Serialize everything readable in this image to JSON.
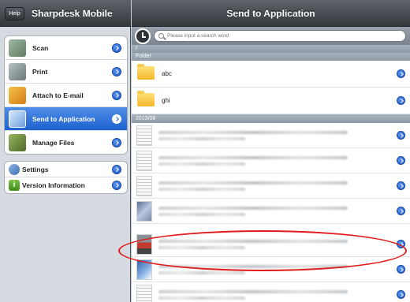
{
  "left_panel": {
    "help_label": "Help",
    "title": "Sharpdesk Mobile",
    "menu": [
      {
        "label": "Scan",
        "icon": "scanner-icon",
        "selected": false
      },
      {
        "label": "Print",
        "icon": "printer-icon",
        "selected": false
      },
      {
        "label": "Attach to E-mail",
        "icon": "email-attach-icon",
        "selected": false
      },
      {
        "label": "Send to Application",
        "icon": "send-to-app-icon",
        "selected": true
      },
      {
        "label": "Manage Files",
        "icon": "manage-files-icon",
        "selected": false
      }
    ],
    "menu2": [
      {
        "label": "Settings",
        "icon": "gear-icon"
      },
      {
        "label": "Version Information",
        "icon": "info-icon"
      }
    ]
  },
  "right_panel": {
    "title": "Send to Application",
    "search": {
      "placeholder": "Please input a search word",
      "value": ""
    },
    "path": "/",
    "folder_section": "Folder",
    "folders": [
      {
        "name": "abc"
      },
      {
        "name": "ghi"
      }
    ],
    "date_section": "2013/08",
    "files": [
      {
        "thumb": "document-thumbnail",
        "blurred": true
      },
      {
        "thumb": "document-thumbnail",
        "blurred": true
      },
      {
        "thumb": "document-thumbnail",
        "blurred": true
      },
      {
        "thumb": "photo-thumbnail",
        "blurred": true
      },
      {
        "thumb": "photo-thumbnail",
        "blurred": true,
        "highlighted": true
      },
      {
        "thumb": "photo-thumbnail",
        "blurred": true
      },
      {
        "thumb": "document-thumbnail",
        "blurred": true
      }
    ]
  },
  "colors": {
    "selected_item": "#1d62d0",
    "disclosure": "#1c57c4",
    "highlight_ellipse": "#e11a1a"
  }
}
